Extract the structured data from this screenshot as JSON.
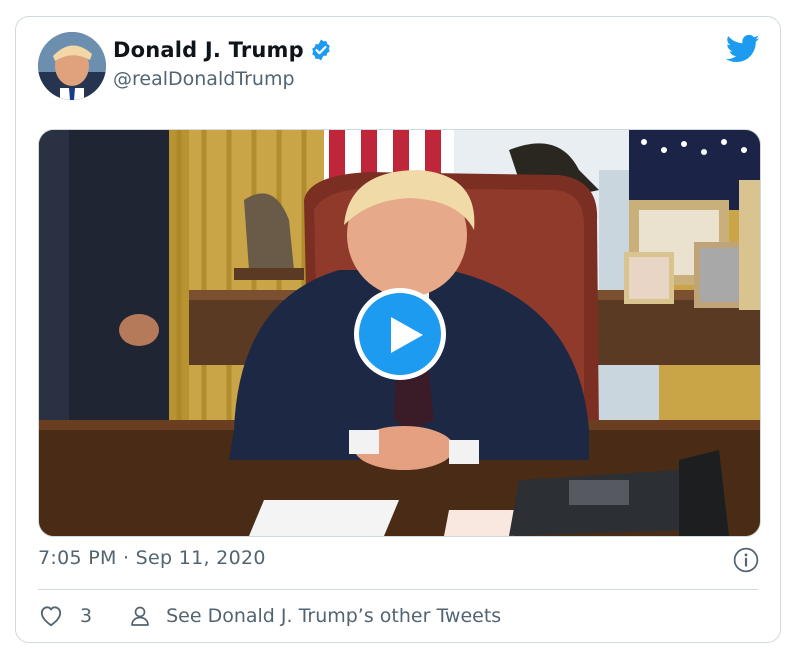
{
  "tweet": {
    "author_name": "Donald J. Trump",
    "author_handle": "@realDonaldTrump",
    "timestamp": "7:05 PM · Sep 11, 2020",
    "like_count": "3",
    "see_more_label": "See Donald J. Trump’s other Tweets"
  },
  "icons": {
    "brand": "twitter-bird-icon",
    "verified": "verified-badge-icon",
    "play": "play-icon",
    "info": "info-icon",
    "like": "heart-icon",
    "profile": "person-icon"
  },
  "colors": {
    "accent": "#1d9bf0",
    "text_primary": "#0f1419",
    "text_secondary": "#536471",
    "border": "#cfd9de"
  }
}
